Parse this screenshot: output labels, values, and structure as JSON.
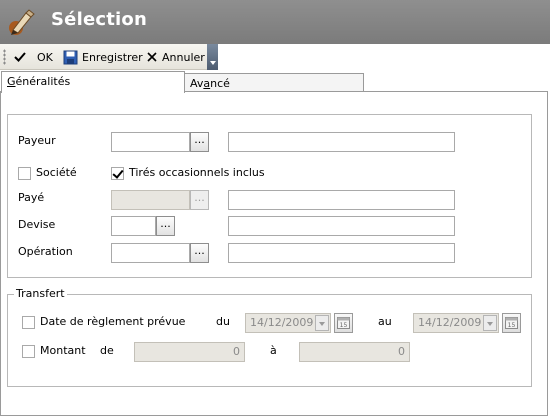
{
  "window": {
    "title": "Sélection"
  },
  "toolbar": {
    "ok_label": "OK",
    "save_label": "Enregistrer",
    "cancel_label": "Annuler"
  },
  "tabs": [
    {
      "label_pre": "",
      "label_u": "G",
      "label_post": "énéralités",
      "active": true
    },
    {
      "label_pre": "Av",
      "label_u": "a",
      "label_post": "ncé",
      "active": false
    }
  ],
  "general": {
    "payeur_label": "Payeur",
    "societe_label": "Société",
    "societe_checked": false,
    "tires_label": "Tirés occasionnels inclus",
    "tires_checked": true,
    "paye_label": "Payé",
    "devise_label": "Devise",
    "operation_label": "Opération",
    "lookup_label": "..."
  },
  "transfert": {
    "legend": "Transfert",
    "date_label": "Date de règlement prévue",
    "date_checked": false,
    "du_label": "du",
    "date_from": "14/12/2009",
    "au_label": "au",
    "date_to": "14/12/2009",
    "montant_label": "Montant",
    "montant_checked": false,
    "de_label": "de",
    "montant_from": "0",
    "a_label": "à",
    "montant_to": "0"
  }
}
